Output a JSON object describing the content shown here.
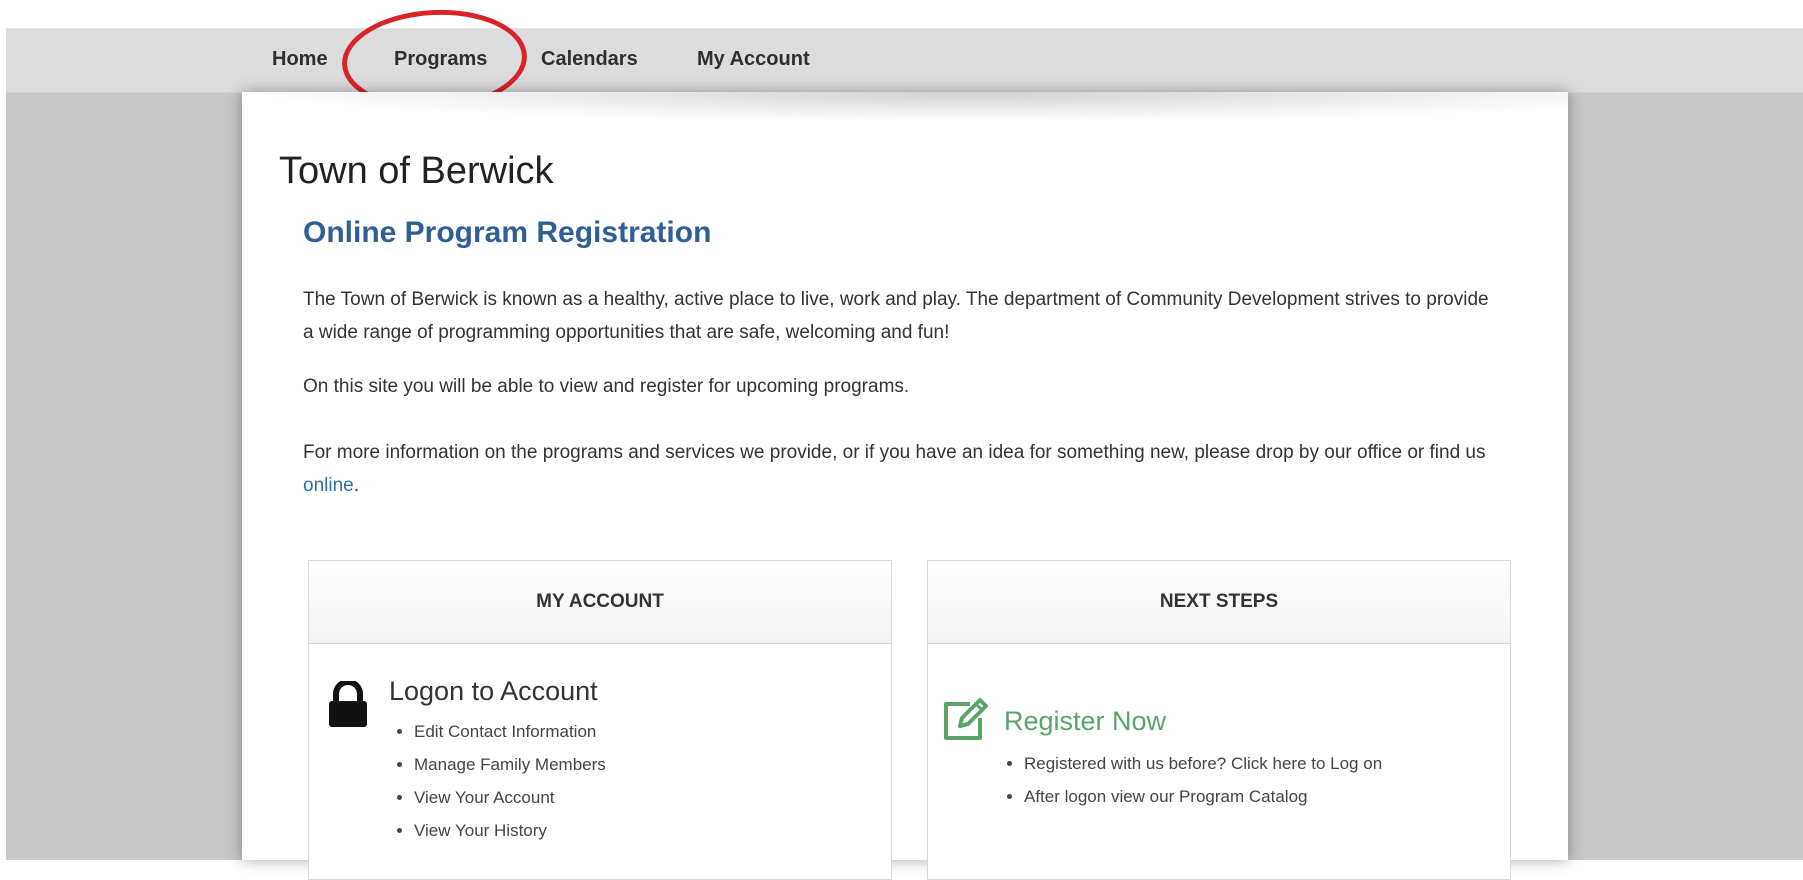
{
  "nav": {
    "items": [
      {
        "label": "Home"
      },
      {
        "label": "Programs"
      },
      {
        "label": "Calendars"
      },
      {
        "label": "My Account"
      }
    ]
  },
  "site": {
    "title": "Town of Berwick",
    "heading": "Online Program Registration"
  },
  "intro": {
    "p1": "The Town of Berwick is known as a healthy, active place to live, work and play. The department of Community Development strives to provide a wide range of programming opportunities that are safe, welcoming and fun!",
    "p2": "On this site you will be able to view and register for upcoming programs.",
    "p3_before": "For more information on the programs and services we provide, or if you have an idea for something new, please drop by our office or find us ",
    "p3_link": "online",
    "p3_after": "."
  },
  "my_account_panel": {
    "header": "MY ACCOUNT",
    "title": "Logon to Account",
    "icon": "lock-icon",
    "items": [
      "Edit Contact Information",
      "Manage Family Members",
      "View Your Account",
      "View Your History"
    ]
  },
  "next_steps_panel": {
    "header": "NEXT STEPS",
    "title": "Register Now",
    "icon": "edit-icon",
    "title_color": "#5aa469",
    "items": [
      "Registered with us before? Click here to Log on",
      "After logon view our Program Catalog"
    ]
  },
  "colors": {
    "heading": "#2f5f96",
    "highlight": "#d9232a",
    "link": "#2f6fa8"
  }
}
